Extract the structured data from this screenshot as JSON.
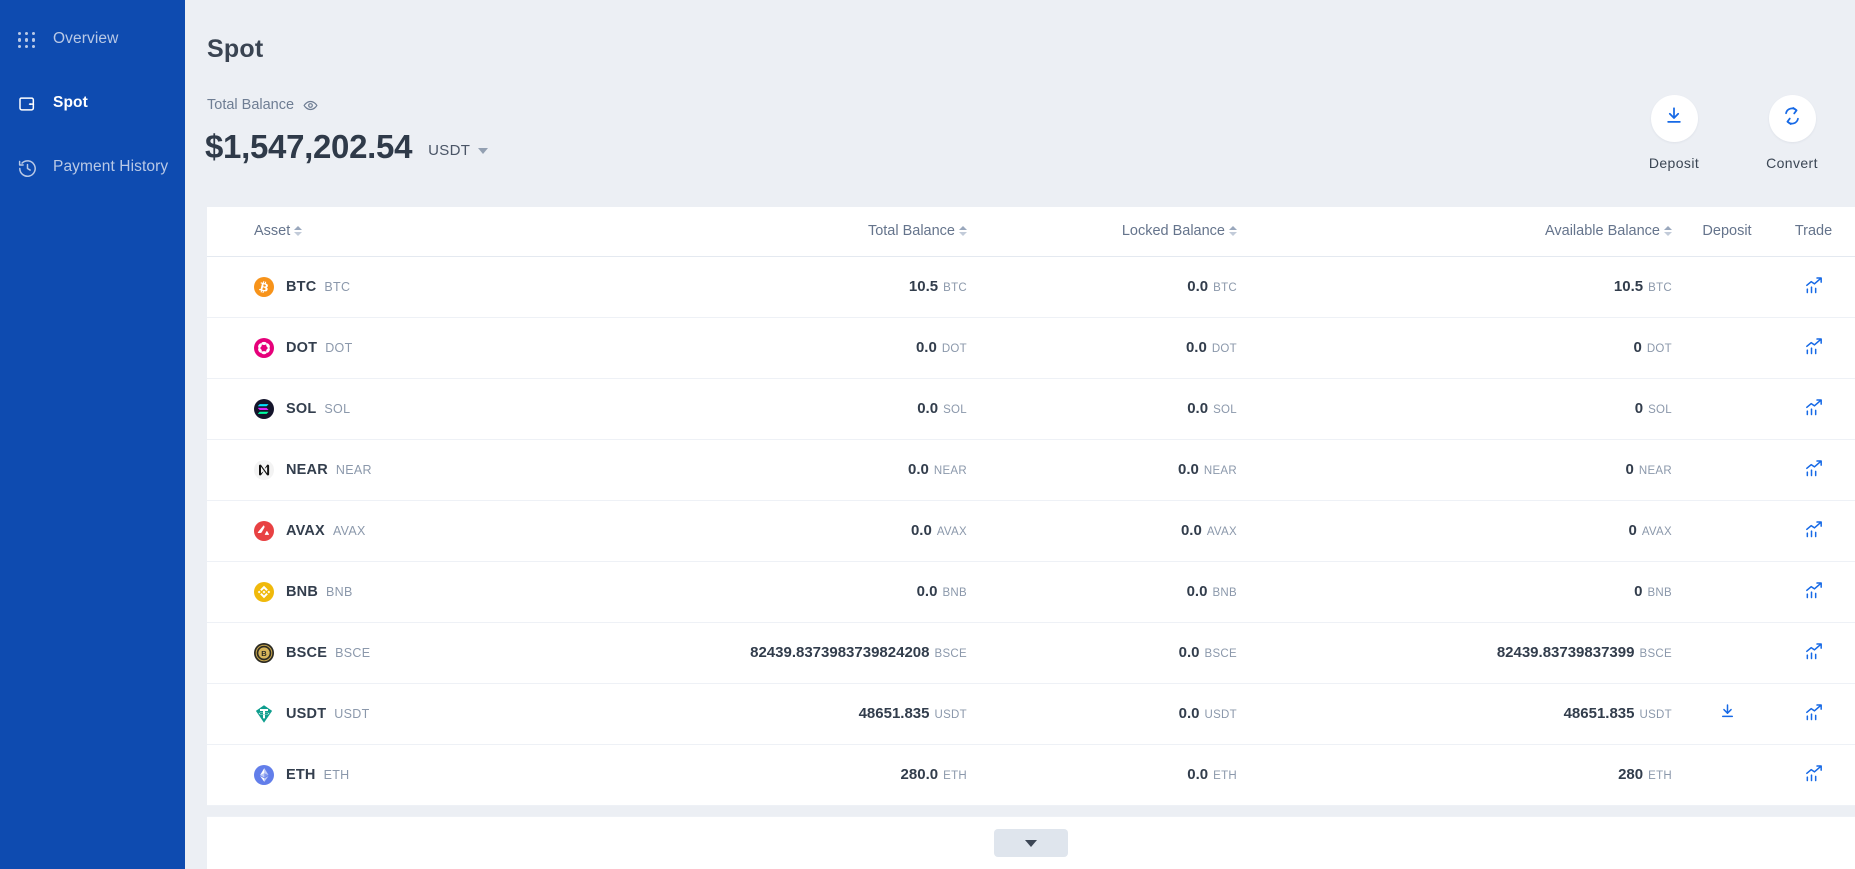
{
  "sidebar": {
    "items": [
      {
        "label": "Overview",
        "icon": "grid-dots-icon",
        "active": false
      },
      {
        "label": "Spot",
        "icon": "wallet-icon",
        "active": true
      },
      {
        "label": "Payment History",
        "icon": "history-clock-icon",
        "active": false
      }
    ],
    "background_color": "#0e4bb0"
  },
  "header": {
    "page_title": "Spot",
    "balance_label": "Total Balance",
    "visibility_icon": "eye-icon",
    "balance_amount": "$1,547,202.54",
    "currency": "USDT",
    "currency_caret_icon": "chevron-down-icon"
  },
  "actions": [
    {
      "label": "Deposit",
      "icon": "download-arrow-icon"
    },
    {
      "label": "Convert",
      "icon": "convert-arrows-icon"
    }
  ],
  "table": {
    "columns": [
      {
        "key": "asset",
        "label": "Asset",
        "sortable": true
      },
      {
        "key": "total",
        "label": "Total Balance",
        "sortable": true
      },
      {
        "key": "locked",
        "label": "Locked Balance",
        "sortable": true
      },
      {
        "key": "avail",
        "label": "Available Balance",
        "sortable": true
      },
      {
        "key": "deposit",
        "label": "Deposit",
        "sortable": false
      },
      {
        "key": "trade",
        "label": "Trade",
        "sortable": false
      }
    ],
    "rows": [
      {
        "name": "BTC",
        "ticker": "BTC",
        "logo": "btc-logo-icon",
        "total": "10.5",
        "total_unit": "BTC",
        "locked": "0.0",
        "locked_unit": "BTC",
        "available": "10.5",
        "available_unit": "BTC",
        "has_deposit": false,
        "has_trade": true
      },
      {
        "name": "DOT",
        "ticker": "DOT",
        "logo": "dot-logo-icon",
        "total": "0.0",
        "total_unit": "DOT",
        "locked": "0.0",
        "locked_unit": "DOT",
        "available": "0",
        "available_unit": "DOT",
        "has_deposit": false,
        "has_trade": true
      },
      {
        "name": "SOL",
        "ticker": "SOL",
        "logo": "sol-logo-icon",
        "total": "0.0",
        "total_unit": "SOL",
        "locked": "0.0",
        "locked_unit": "SOL",
        "available": "0",
        "available_unit": "SOL",
        "has_deposit": false,
        "has_trade": true
      },
      {
        "name": "NEAR",
        "ticker": "NEAR",
        "logo": "near-logo-icon",
        "total": "0.0",
        "total_unit": "NEAR",
        "locked": "0.0",
        "locked_unit": "NEAR",
        "available": "0",
        "available_unit": "NEAR",
        "has_deposit": false,
        "has_trade": true
      },
      {
        "name": "AVAX",
        "ticker": "AVAX",
        "logo": "avax-logo-icon",
        "total": "0.0",
        "total_unit": "AVAX",
        "locked": "0.0",
        "locked_unit": "AVAX",
        "available": "0",
        "available_unit": "AVAX",
        "has_deposit": false,
        "has_trade": true
      },
      {
        "name": "BNB",
        "ticker": "BNB",
        "logo": "bnb-logo-icon",
        "total": "0.0",
        "total_unit": "BNB",
        "locked": "0.0",
        "locked_unit": "BNB",
        "available": "0",
        "available_unit": "BNB",
        "has_deposit": false,
        "has_trade": true
      },
      {
        "name": "BSCE",
        "ticker": "BSCE",
        "logo": "bsce-logo-icon",
        "total": "82439.8373983739824208",
        "total_unit": "BSCE",
        "locked": "0.0",
        "locked_unit": "BSCE",
        "available": "82439.83739837399",
        "available_unit": "BSCE",
        "has_deposit": false,
        "has_trade": true
      },
      {
        "name": "USDT",
        "ticker": "USDT",
        "logo": "usdt-logo-icon",
        "total": "48651.835",
        "total_unit": "USDT",
        "locked": "0.0",
        "locked_unit": "USDT",
        "available": "48651.835",
        "available_unit": "USDT",
        "has_deposit": true,
        "has_trade": true
      },
      {
        "name": "ETH",
        "ticker": "ETH",
        "logo": "eth-logo-icon",
        "total": "280.0",
        "total_unit": "ETH",
        "locked": "0.0",
        "locked_unit": "ETH",
        "available": "280",
        "available_unit": "ETH",
        "has_deposit": false,
        "has_trade": true
      }
    ]
  },
  "footer": {
    "expand_icon": "chevron-down-icon"
  },
  "colors": {
    "sidebar": "#0e4bb0",
    "accent": "#1669e6",
    "page_bg": "#eceff4",
    "card_bg": "#ffffff",
    "btc": "#f7931a",
    "dot": "#e6007a",
    "sol": "#14142b",
    "near": "#f2f2f2",
    "avax": "#e84142",
    "bnb": "#f0b90b",
    "bsce": "#2e2a20",
    "usdt": "#0f9e8e",
    "eth": "#627eea"
  }
}
